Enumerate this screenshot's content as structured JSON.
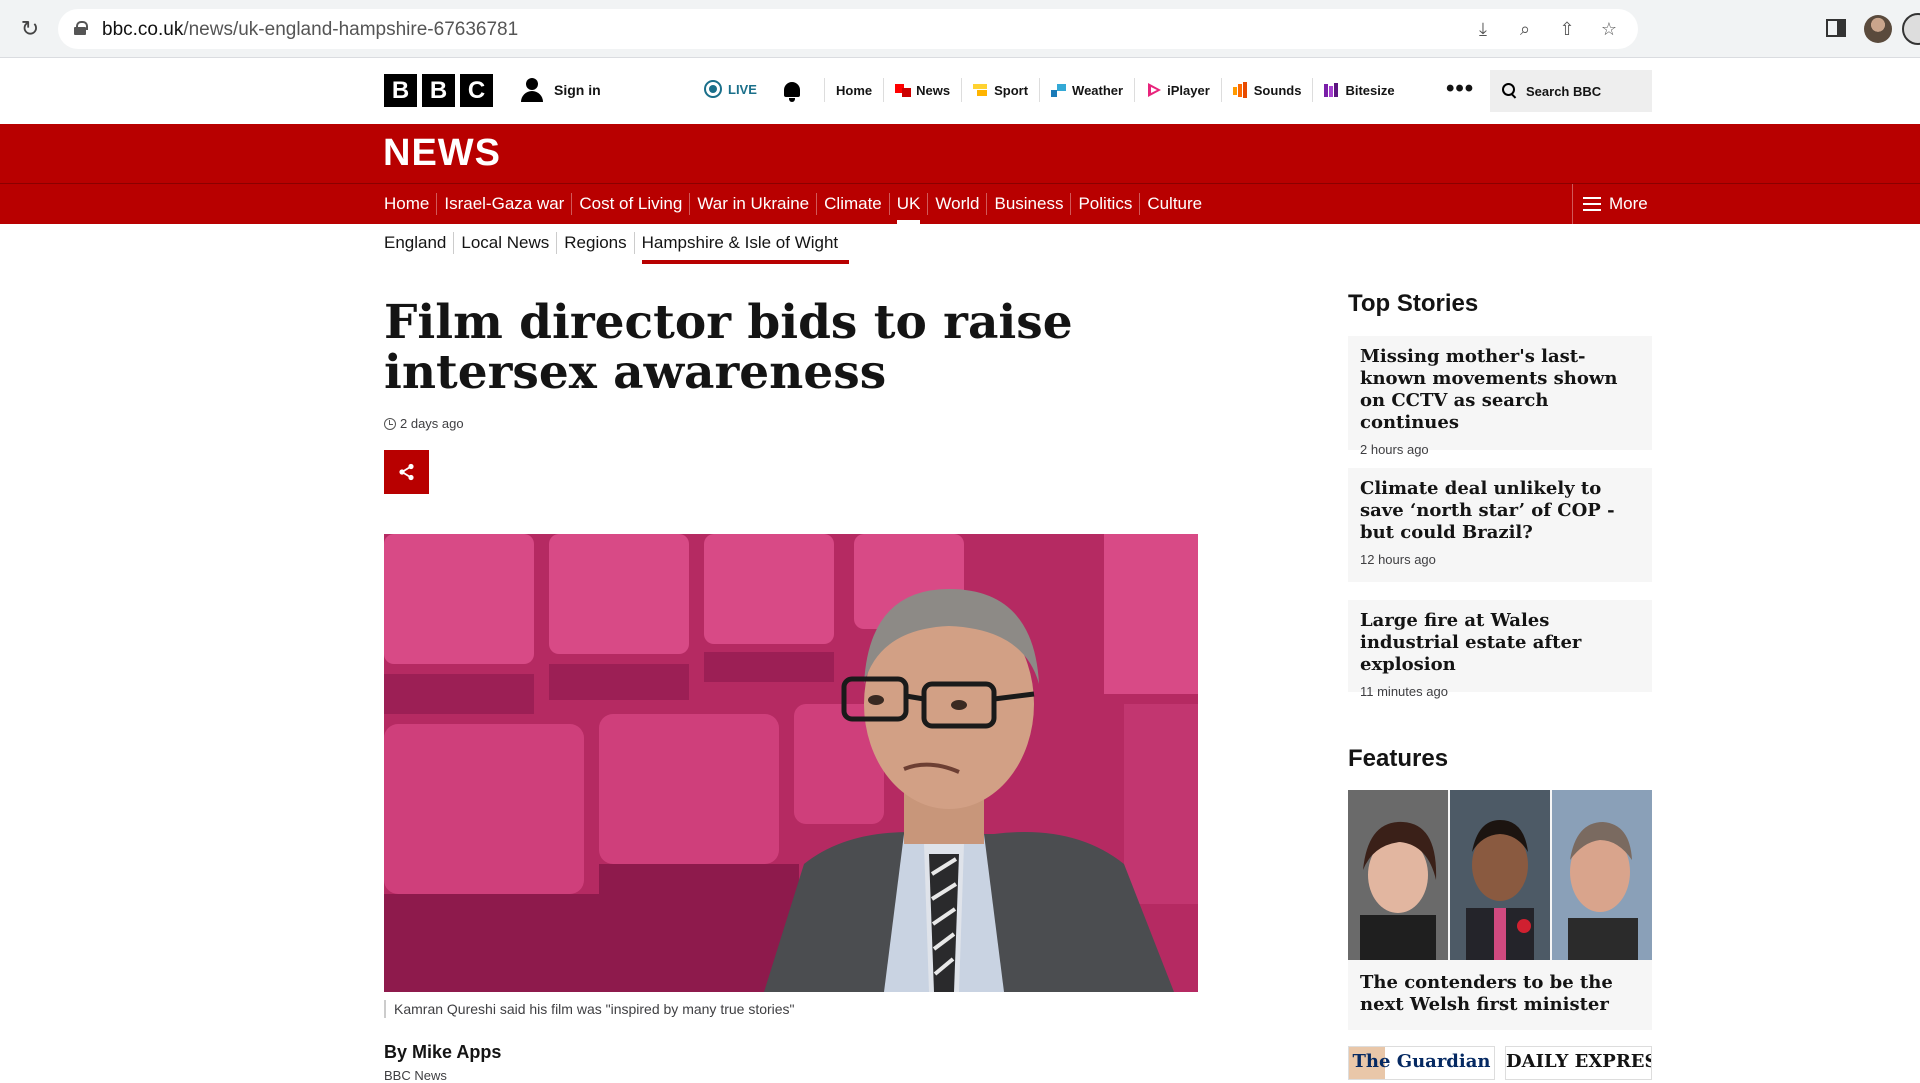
{
  "browser": {
    "url_domain": "bbc.co.uk",
    "url_path": "/news/uk-england-hampshire-67636781"
  },
  "masthead": {
    "logo_letters": [
      "B",
      "B",
      "C"
    ],
    "signin_label": "Sign in",
    "live_label": "LIVE",
    "nav": [
      {
        "label": "Home",
        "icon": "none",
        "color": "#000000"
      },
      {
        "label": "News",
        "icon": "news-icon",
        "color": "#ff0000"
      },
      {
        "label": "Sport",
        "icon": "sport-icon",
        "color": "#ffd230"
      },
      {
        "label": "Weather",
        "icon": "weather-icon",
        "color": "#1a7bb8"
      },
      {
        "label": "iPlayer",
        "icon": "iplayer-icon",
        "color": "#e8247c"
      },
      {
        "label": "Sounds",
        "icon": "sounds-icon",
        "color": "#ff6a00"
      },
      {
        "label": "Bitesize",
        "icon": "bitesize-icon",
        "color": "#7a1fa8"
      }
    ],
    "more_label": "•••",
    "search_label": "Search BBC"
  },
  "news": {
    "title": "NEWS",
    "tabs": [
      "Home",
      "Israel-Gaza war",
      "Cost of Living",
      "War in Ukraine",
      "Climate",
      "UK",
      "World",
      "Business",
      "Politics",
      "Culture"
    ],
    "active_tab": "UK",
    "more_label": "More",
    "subtabs": [
      "England",
      "Local News",
      "Regions",
      "Hampshire & Isle of Wight"
    ],
    "active_subtab": "Hampshire & Isle of Wight"
  },
  "article": {
    "headline": "Film director bids to raise intersex awareness",
    "timestamp": "2 days ago",
    "caption": "Kamran Qureshi said his film was \"inspired by many true stories\"",
    "byline": "By Mike Apps",
    "byline_org": "BBC News"
  },
  "sidebar": {
    "top_stories_heading": "Top Stories",
    "top_stories": [
      {
        "title": "Missing mother's last-known movements shown on CCTV as search continues",
        "time": "2 hours ago"
      },
      {
        "title": "Climate deal unlikely to save ‘north star’ of COP - but could Brazil?",
        "time": "12 hours ago"
      },
      {
        "title": "Large fire at Wales industrial estate after explosion",
        "time": "11 minutes ago"
      }
    ],
    "features_heading": "Features",
    "feature_title": "The contenders to be the next Welsh first minister",
    "papers": [
      "The Guardian",
      "DAILY EXPRESS"
    ]
  },
  "colors": {
    "bbc_red": "#b80000",
    "seat_pink": "#c1346d"
  }
}
